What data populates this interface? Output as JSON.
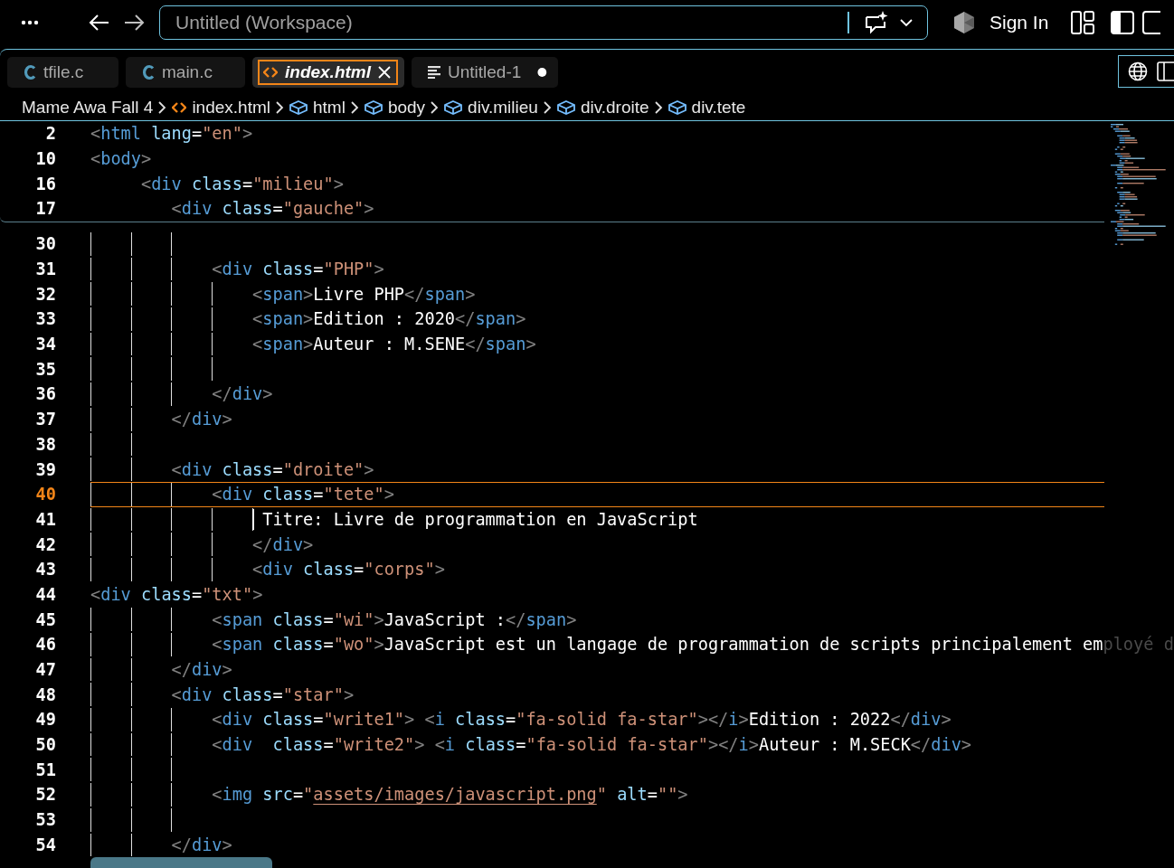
{
  "titlebar": {
    "workspace": "Untitled (Workspace)",
    "sign_in": "Sign In"
  },
  "tabs": [
    {
      "label": "tfile.c",
      "kind": "c",
      "selected": false,
      "dirty": false
    },
    {
      "label": "main.c",
      "kind": "c",
      "selected": false,
      "dirty": false
    },
    {
      "label": "index.html",
      "kind": "html",
      "selected": true,
      "dirty": false
    },
    {
      "label": "Untitled-1",
      "kind": "text",
      "selected": false,
      "dirty": true
    }
  ],
  "breadcrumb": [
    {
      "label": "Mame Awa Fall 4",
      "kind": "folder"
    },
    {
      "label": "index.html",
      "kind": "file"
    },
    {
      "label": "html",
      "kind": "element"
    },
    {
      "label": "body",
      "kind": "element"
    },
    {
      "label": "div.milieu",
      "kind": "element"
    },
    {
      "label": "div.droite",
      "kind": "element"
    },
    {
      "label": "div.tete",
      "kind": "element"
    }
  ],
  "sticky_lines": [
    {
      "number": "2",
      "tokens": [
        {
          "kind": "punct",
          "text": "<"
        },
        {
          "kind": "tag",
          "text": "html"
        },
        {
          "kind": "attr",
          "text": " lang"
        },
        {
          "kind": "text",
          "text": "="
        },
        {
          "kind": "str",
          "text": "\"en\""
        },
        {
          "kind": "punct",
          "text": ">"
        }
      ]
    },
    {
      "number": "10",
      "tokens": [
        {
          "kind": "punct",
          "text": "<"
        },
        {
          "kind": "tag",
          "text": "body"
        },
        {
          "kind": "punct",
          "text": ">"
        }
      ]
    },
    {
      "number": "16",
      "tokens": [
        {
          "kind": "punct",
          "text": "     <"
        },
        {
          "kind": "tag",
          "text": "div"
        },
        {
          "kind": "attr",
          "text": " class"
        },
        {
          "kind": "text",
          "text": "="
        },
        {
          "kind": "str",
          "text": "\"milieu\""
        },
        {
          "kind": "punct",
          "text": ">"
        }
      ]
    },
    {
      "number": "17",
      "tokens": [
        {
          "kind": "punct",
          "text": "        <"
        },
        {
          "kind": "tag",
          "text": "div"
        },
        {
          "kind": "attr",
          "text": " class"
        },
        {
          "kind": "text",
          "text": "="
        },
        {
          "kind": "str",
          "text": "\"gauche\""
        },
        {
          "kind": "punct",
          "text": ">"
        }
      ]
    }
  ],
  "lines": [
    {
      "number": "30",
      "current": false,
      "cursor": false
    },
    {
      "number": "31",
      "current": false,
      "cursor": false,
      "tokens": [
        {
          "kind": "punct",
          "text": "            <"
        },
        {
          "kind": "tag",
          "text": "div"
        },
        {
          "kind": "attr",
          "text": " class"
        },
        {
          "kind": "text",
          "text": "="
        },
        {
          "kind": "str",
          "text": "\"PHP\""
        },
        {
          "kind": "punct",
          "text": ">"
        }
      ]
    },
    {
      "number": "32",
      "current": false,
      "cursor": false,
      "tokens": [
        {
          "kind": "punct",
          "text": "                <"
        },
        {
          "kind": "tag",
          "text": "span"
        },
        {
          "kind": "punct",
          "text": ">"
        },
        {
          "kind": "text",
          "text": "Livre PHP"
        },
        {
          "kind": "punct",
          "text": "</"
        },
        {
          "kind": "tag",
          "text": "span"
        },
        {
          "kind": "punct",
          "text": ">"
        }
      ]
    },
    {
      "number": "33",
      "current": false,
      "cursor": false,
      "tokens": [
        {
          "kind": "punct",
          "text": "                <"
        },
        {
          "kind": "tag",
          "text": "span"
        },
        {
          "kind": "punct",
          "text": ">"
        },
        {
          "kind": "text",
          "text": "Edition : 2020"
        },
        {
          "kind": "punct",
          "text": "</"
        },
        {
          "kind": "tag",
          "text": "span"
        },
        {
          "kind": "punct",
          "text": ">"
        }
      ]
    },
    {
      "number": "34",
      "current": false,
      "cursor": false,
      "tokens": [
        {
          "kind": "punct",
          "text": "                <"
        },
        {
          "kind": "tag",
          "text": "span"
        },
        {
          "kind": "punct",
          "text": ">"
        },
        {
          "kind": "text",
          "text": "Auteur : M.SENE"
        },
        {
          "kind": "punct",
          "text": "</"
        },
        {
          "kind": "tag",
          "text": "span"
        },
        {
          "kind": "punct",
          "text": ">"
        }
      ]
    },
    {
      "number": "35",
      "current": false,
      "cursor": false
    },
    {
      "number": "36",
      "current": false,
      "cursor": false,
      "tokens": [
        {
          "kind": "punct",
          "text": "            </"
        },
        {
          "kind": "tag",
          "text": "div"
        },
        {
          "kind": "punct",
          "text": ">"
        }
      ]
    },
    {
      "number": "37",
      "current": false,
      "cursor": false,
      "tokens": [
        {
          "kind": "punct",
          "text": "        </"
        },
        {
          "kind": "tag",
          "text": "div"
        },
        {
          "kind": "punct",
          "text": ">"
        }
      ]
    },
    {
      "number": "38",
      "current": false,
      "cursor": false
    },
    {
      "number": "39",
      "current": false,
      "cursor": false,
      "tokens": [
        {
          "kind": "punct",
          "text": "        <"
        },
        {
          "kind": "tag",
          "text": "div"
        },
        {
          "kind": "attr",
          "text": " class"
        },
        {
          "kind": "text",
          "text": "="
        },
        {
          "kind": "str",
          "text": "\"droite\""
        },
        {
          "kind": "punct",
          "text": ">"
        }
      ]
    },
    {
      "number": "40",
      "current": true,
      "cursor": false,
      "tokens": [
        {
          "kind": "punct",
          "text": "            <"
        },
        {
          "kind": "tag",
          "text": "div"
        },
        {
          "kind": "attr",
          "text": " class"
        },
        {
          "kind": "text",
          "text": "="
        },
        {
          "kind": "str",
          "text": "\"tete\""
        },
        {
          "kind": "punct",
          "text": ">"
        }
      ]
    },
    {
      "number": "41",
      "current": false,
      "cursor": true,
      "tokens": [
        {
          "kind": "text",
          "text": "                 Titre: Livre de programmation en JavaScript"
        }
      ]
    },
    {
      "number": "42",
      "current": false,
      "cursor": false,
      "tokens": [
        {
          "kind": "punct",
          "text": "                </"
        },
        {
          "kind": "tag",
          "text": "div"
        },
        {
          "kind": "punct",
          "text": ">"
        }
      ]
    },
    {
      "number": "43",
      "current": false,
      "cursor": false,
      "tokens": [
        {
          "kind": "punct",
          "text": "                <"
        },
        {
          "kind": "tag",
          "text": "div"
        },
        {
          "kind": "attr",
          "text": " class"
        },
        {
          "kind": "text",
          "text": "="
        },
        {
          "kind": "str",
          "text": "\"corps\""
        },
        {
          "kind": "punct",
          "text": ">"
        }
      ]
    },
    {
      "number": "44",
      "current": false,
      "cursor": false,
      "tokens": [
        {
          "kind": "punct",
          "text": "<"
        },
        {
          "kind": "tag",
          "text": "div"
        },
        {
          "kind": "attr",
          "text": " class"
        },
        {
          "kind": "text",
          "text": "="
        },
        {
          "kind": "str",
          "text": "\"txt\""
        },
        {
          "kind": "punct",
          "text": ">"
        }
      ]
    },
    {
      "number": "45",
      "current": false,
      "cursor": false,
      "tokens": [
        {
          "kind": "punct",
          "text": "            <"
        },
        {
          "kind": "tag",
          "text": "span"
        },
        {
          "kind": "attr",
          "text": " class"
        },
        {
          "kind": "text",
          "text": "="
        },
        {
          "kind": "str",
          "text": "\"wi\""
        },
        {
          "kind": "punct",
          "text": ">"
        },
        {
          "kind": "text",
          "text": "JavaScript :"
        },
        {
          "kind": "punct",
          "text": "</"
        },
        {
          "kind": "tag",
          "text": "span"
        },
        {
          "kind": "punct",
          "text": ">"
        }
      ]
    },
    {
      "number": "46",
      "current": false,
      "cursor": false,
      "tokens": [
        {
          "kind": "punct",
          "text": "            <"
        },
        {
          "kind": "tag",
          "text": "span"
        },
        {
          "kind": "attr",
          "text": " class"
        },
        {
          "kind": "text",
          "text": "="
        },
        {
          "kind": "str",
          "text": "\"wo\""
        },
        {
          "kind": "punct",
          "text": ">"
        },
        {
          "kind": "text",
          "text": "JavaScript est un langage de programmation de scripts principalement em"
        },
        {
          "kind": "faded",
          "text": "ployé d"
        }
      ]
    },
    {
      "number": "47",
      "current": false,
      "cursor": false,
      "tokens": [
        {
          "kind": "punct",
          "text": "        </"
        },
        {
          "kind": "tag",
          "text": "div"
        },
        {
          "kind": "punct",
          "text": ">"
        }
      ]
    },
    {
      "number": "48",
      "current": false,
      "cursor": false,
      "tokens": [
        {
          "kind": "punct",
          "text": "        <"
        },
        {
          "kind": "tag",
          "text": "div"
        },
        {
          "kind": "attr",
          "text": " class"
        },
        {
          "kind": "text",
          "text": "="
        },
        {
          "kind": "str",
          "text": "\"star\""
        },
        {
          "kind": "punct",
          "text": ">"
        }
      ]
    },
    {
      "number": "49",
      "current": false,
      "cursor": false,
      "tokens": [
        {
          "kind": "punct",
          "text": "            <"
        },
        {
          "kind": "tag",
          "text": "div"
        },
        {
          "kind": "attr",
          "text": " class"
        },
        {
          "kind": "text",
          "text": "="
        },
        {
          "kind": "str",
          "text": "\"write1\""
        },
        {
          "kind": "punct",
          "text": "> <"
        },
        {
          "kind": "tag",
          "text": "i"
        },
        {
          "kind": "attr",
          "text": " class"
        },
        {
          "kind": "text",
          "text": "="
        },
        {
          "kind": "str",
          "text": "\"fa-solid fa-star\""
        },
        {
          "kind": "punct",
          "text": "></"
        },
        {
          "kind": "tag",
          "text": "i"
        },
        {
          "kind": "punct",
          "text": ">"
        },
        {
          "kind": "text",
          "text": "Edition : 2022"
        },
        {
          "kind": "punct",
          "text": "</"
        },
        {
          "kind": "tag",
          "text": "div"
        },
        {
          "kind": "punct",
          "text": ">"
        }
      ]
    },
    {
      "number": "50",
      "current": false,
      "cursor": false,
      "tokens": [
        {
          "kind": "punct",
          "text": "            <"
        },
        {
          "kind": "tag",
          "text": "div"
        },
        {
          "kind": "attr",
          "text": "  class"
        },
        {
          "kind": "text",
          "text": "="
        },
        {
          "kind": "str",
          "text": "\"write2\""
        },
        {
          "kind": "punct",
          "text": "> <"
        },
        {
          "kind": "tag",
          "text": "i"
        },
        {
          "kind": "attr",
          "text": " class"
        },
        {
          "kind": "text",
          "text": "="
        },
        {
          "kind": "str",
          "text": "\"fa-solid fa-star\""
        },
        {
          "kind": "punct",
          "text": "></"
        },
        {
          "kind": "tag",
          "text": "i"
        },
        {
          "kind": "punct",
          "text": ">"
        },
        {
          "kind": "text",
          "text": "Auteur : M.SECK"
        },
        {
          "kind": "punct",
          "text": "</"
        },
        {
          "kind": "tag",
          "text": "div"
        },
        {
          "kind": "punct",
          "text": ">"
        }
      ]
    },
    {
      "number": "51",
      "current": false,
      "cursor": false
    },
    {
      "number": "52",
      "current": false,
      "cursor": false,
      "tokens": [
        {
          "kind": "punct",
          "text": "            <"
        },
        {
          "kind": "tag",
          "text": "img"
        },
        {
          "kind": "attr",
          "text": " src"
        },
        {
          "kind": "text",
          "text": "="
        },
        {
          "kind": "str",
          "text": "\""
        },
        {
          "kind": "link",
          "text": "assets/images/javascript.png"
        },
        {
          "kind": "str",
          "text": "\""
        },
        {
          "kind": "attr",
          "text": " alt"
        },
        {
          "kind": "text",
          "text": "="
        },
        {
          "kind": "str",
          "text": "\"\""
        },
        {
          "kind": "punct",
          "text": ">"
        }
      ]
    },
    {
      "number": "53",
      "current": false,
      "cursor": false
    },
    {
      "number": "54",
      "current": false,
      "cursor": false,
      "tokens": [
        {
          "kind": "punct",
          "text": "        </"
        },
        {
          "kind": "tag",
          "text": "div"
        },
        {
          "kind": "punct",
          "text": ">"
        }
      ]
    }
  ]
}
